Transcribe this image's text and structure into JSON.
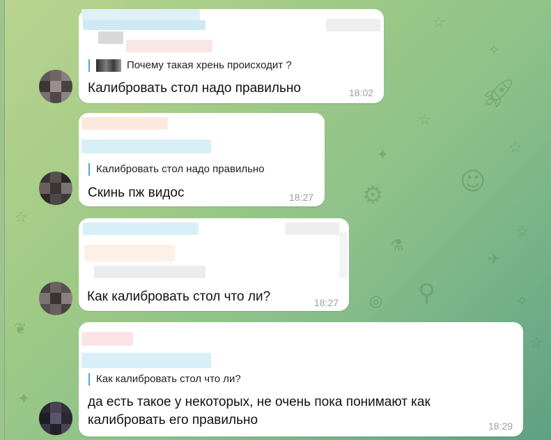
{
  "messages": [
    {
      "reply_text": "Почему такая хрень происходит ?",
      "text": "Калибровать стол надо правильно",
      "time": "18:02"
    },
    {
      "reply_text": "Калибровать стол надо правильно",
      "text": "Скинь пж видос",
      "time": "18:27"
    },
    {
      "reply_text": "",
      "text": "Как калибровать стол что ли?",
      "time": "18:27"
    },
    {
      "reply_text": "Как калибровать стол что ли?",
      "text_line1": "да есть такое у некоторых, не очень пока понимают как",
      "text_line2": "калибровать его правильно",
      "time": "18:29"
    }
  ],
  "colors": {
    "bubble": "#ffffff",
    "reply_accent": "#4da3e0",
    "time": "#9aa0a6",
    "background": "#9fca86"
  }
}
